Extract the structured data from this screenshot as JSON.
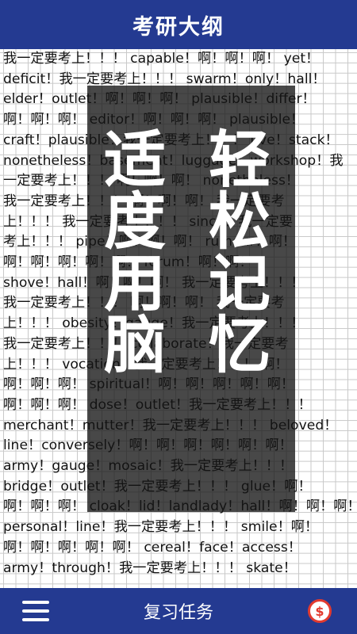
{
  "header": {
    "title": "考研大纲"
  },
  "content": {
    "lines": [
      "我一定要考上！！！ capable！啊！啊！啊！ yet！",
      "deficit！我一定要考上！！！ swarm！only！hall！",
      "elder！outlet！啊！啊！啊！ plausible！differ！",
      "啊！啊！啊！ editor！啊！啊！啊！ plausible！",
      "craft！plausible！我一定要考上！！！ five！stack！",
      "nonetheless！basement！luggage！workshop！我",
      "一定要考上！！！ 啊！啊！啊！ nonetheless！",
      "我一定要考上！！！ 啊！啊！啊！ 我一定要考",
      "上！！！ 我一定要考上！！！ since！我一定要",
      "考上！！！ pipe！啊！啊！啊！ rumour！啊！",
      "啊！啊！啊！啊！啊！ forum！啊！啊！",
      "shove！hall！啊！啊！啊！ 我一定要考上！！！",
      "我一定要考上！！！ 啊！啊！啊！ 我一定要考",
      "上！！！ obesity！gauge！我一定要考上！！！",
      "我一定要考上！！！ collaborate！我一定要考",
      "上！！！ vocation！我一定要考上！！！ 啊！",
      "啊！啊！啊！ spiritual！啊！啊！啊！啊！啊！",
      "啊！啊！啊！ dose！outlet！我一定要考上！！！",
      "merchant！mutter！我一定要考上！！！ beloved！",
      "line！conversely！啊！啊！啊！啊！啊！啊！",
      "army！gauge！mosaic！我一定要考上！！！",
      "bridge！outlet！我一定要考上！！！ glue！啊！",
      "啊！啊！啊！ cloak！lid！landlady！hall！啊！啊！啊！",
      "personal！line！我一定要考上！！！ smile！啊！",
      "啊！啊！啊！啊！啊！ cereal！face！access！",
      "army！through！我一定要考上！！！ skate！"
    ]
  },
  "overlay": {
    "slogan_left": "适度用脑",
    "slogan_right": "轻松记忆"
  },
  "footer": {
    "label": "复习任务",
    "menu_icon": "hamburger-menu-icon",
    "coin_icon": "coin-icon",
    "coin_symbol": "$",
    "accent_color": "#243a91",
    "coin_color": "#e23a2f"
  }
}
